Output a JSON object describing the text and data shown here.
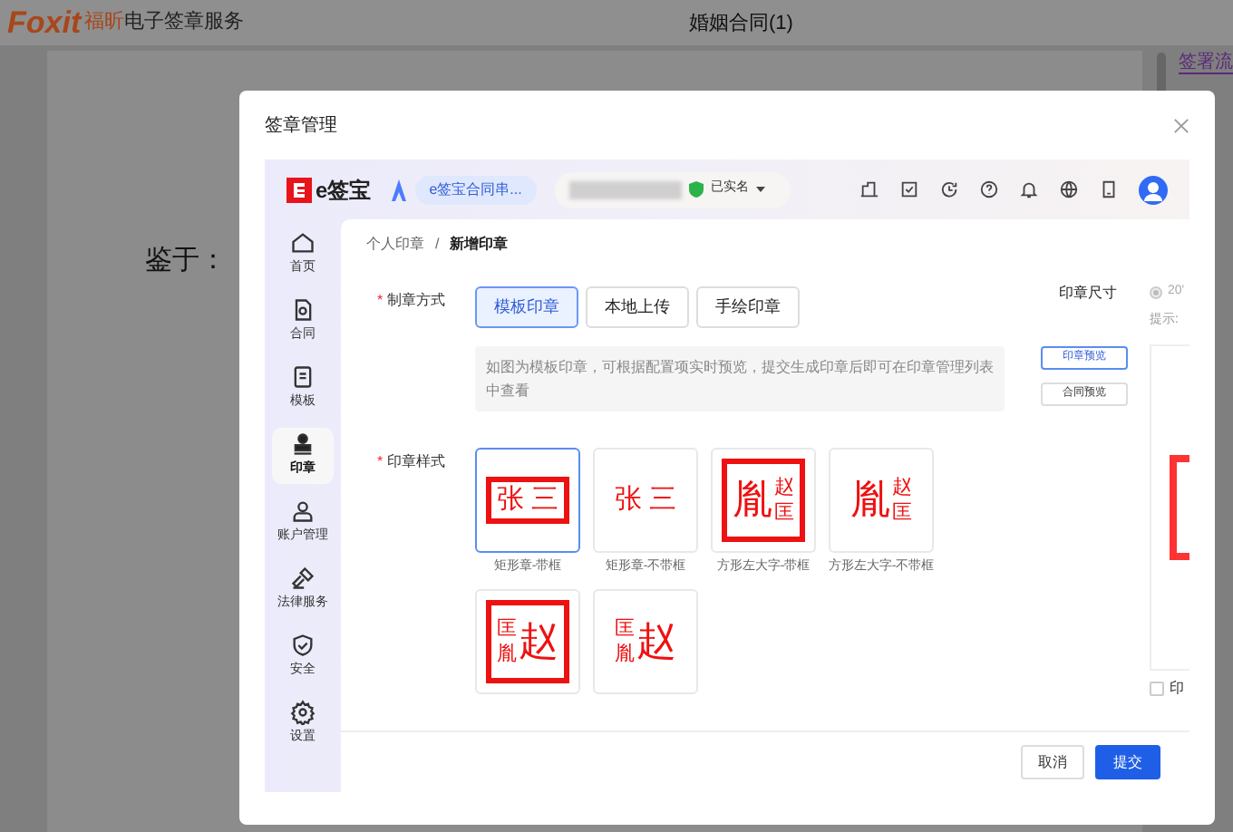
{
  "app": {
    "logo": "Foxit",
    "brand": "福昕",
    "product": "电子签章服务",
    "document_title": "婚姻合同(1)",
    "document_text": "鉴于：",
    "side_tab": "签署流"
  },
  "dialog": {
    "title": "签章管理",
    "esign": {
      "logo": "e签宝",
      "org": "e签宝合同串...",
      "verified": "已实名",
      "nav": [
        {
          "label": "首页",
          "selected": false
        },
        {
          "label": "合同",
          "selected": false
        },
        {
          "label": "模板",
          "selected": false
        },
        {
          "label": "印章",
          "selected": true
        },
        {
          "label": "账户管理",
          "selected": false
        },
        {
          "label": "法律服务",
          "selected": false
        },
        {
          "label": "安全",
          "selected": false
        },
        {
          "label": "设置",
          "selected": false
        }
      ],
      "breadcrumb": [
        "个人印章",
        "新增印章"
      ],
      "breadcrumb_separator": "/",
      "required_mark": "*",
      "method_label": "制章方式",
      "methods": [
        {
          "label": "模板印章",
          "selected": true
        },
        {
          "label": "本地上传",
          "selected": false
        },
        {
          "label": "手绘印章",
          "selected": false
        }
      ],
      "hint": "如图为模板印章，可根据配置项实时预览，提交生成印章后即可在印章管理列表中查看",
      "style_label": "印章样式",
      "seals": [
        {
          "kind": "rect",
          "text": "张 三",
          "framed": true,
          "selected": true,
          "caption": "矩形章-带框"
        },
        {
          "kind": "rect",
          "text": "张 三",
          "framed": false,
          "selected": false,
          "caption": "矩形章-不带框"
        },
        {
          "kind": "square_left",
          "big": "胤",
          "small": [
            "赵",
            "匡"
          ],
          "framed": true,
          "selected": false,
          "caption": "方形左大字-带框"
        },
        {
          "kind": "square_left",
          "big": "胤",
          "small": [
            "赵",
            "匡"
          ],
          "framed": false,
          "selected": false,
          "caption": "方形左大字-不带框"
        },
        {
          "kind": "square_right",
          "big": "赵",
          "small": [
            "匡",
            "胤"
          ],
          "framed": true,
          "selected": false
        },
        {
          "kind": "square_right",
          "big": "赵",
          "small": [
            "匡",
            "胤"
          ],
          "framed": false,
          "selected": false
        }
      ],
      "size_label": "印章尺寸",
      "size_option": {
        "label": "20'",
        "selected": true
      },
      "size_hint": "提示:",
      "preview_buttons": [
        "印章预览",
        "合同预览"
      ],
      "preview_checkbox": {
        "label": "印",
        "checked": false
      },
      "buttons": {
        "cancel": "取消",
        "submit": "提交"
      }
    }
  }
}
